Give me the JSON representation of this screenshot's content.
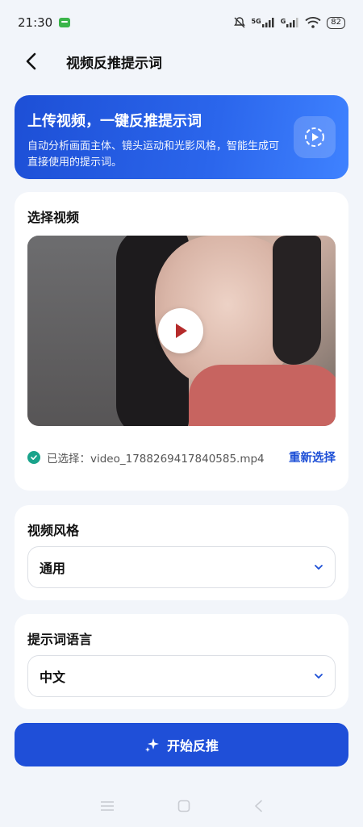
{
  "status_bar": {
    "time": "21:30",
    "network_label": "5G",
    "signal2_label": "G",
    "battery_level": "82"
  },
  "header": {
    "title": "视频反推提示词"
  },
  "hero": {
    "title": "上传视频，一键反推提示词",
    "description": "自动分析画面主体、镜头运动和光影风格，智能生成可直接使用的提示词。"
  },
  "video_section": {
    "title": "选择视频",
    "selected_prefix": "已选择：",
    "file_name": "video_1788269417840585.mp4",
    "reselect_label": "重新选择"
  },
  "style_section": {
    "title": "视频风格",
    "selected_value": "通用"
  },
  "language_section": {
    "title": "提示词语言",
    "selected_value": "中文"
  },
  "primary_button": {
    "label": "开始反推"
  },
  "colors": {
    "accent": "#1f4fd8",
    "success": "#19a38b",
    "background": "#f2f5fa"
  },
  "icons": {
    "back": "back-arrow-icon",
    "hero": "video-analyze-icon",
    "play": "play-icon",
    "check": "check-circle-icon",
    "dropdown": "chevron-down-icon",
    "sparkle": "sparkle-icon"
  }
}
